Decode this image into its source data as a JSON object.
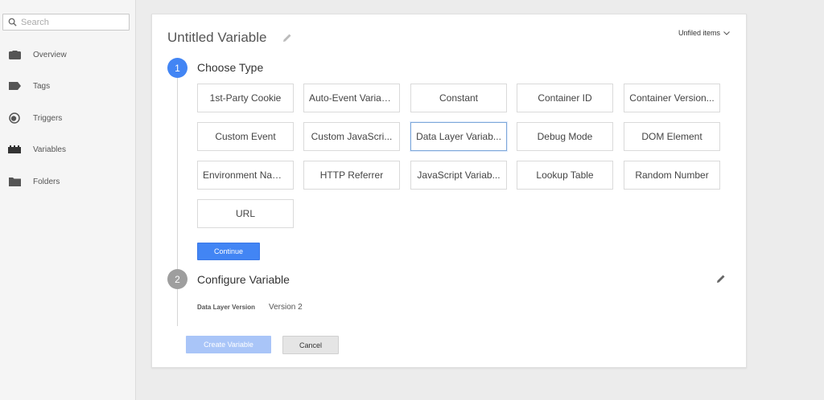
{
  "sidebar": {
    "search_placeholder": "Search",
    "items": [
      {
        "label": "Overview",
        "icon": "briefcase-icon"
      },
      {
        "label": "Tags",
        "icon": "tag-icon"
      },
      {
        "label": "Triggers",
        "icon": "trigger-icon"
      },
      {
        "label": "Variables",
        "icon": "variables-icon"
      },
      {
        "label": "Folders",
        "icon": "folder-icon"
      }
    ]
  },
  "card": {
    "title": "Untitled Variable",
    "folder_dropdown": "Unfiled items",
    "step1": {
      "number": "1",
      "title": "Choose Type",
      "types": [
        "1st-Party Cookie",
        "Auto-Event Variab...",
        "Constant",
        "Container ID",
        "Container Version...",
        "Custom Event",
        "Custom JavaScri...",
        "Data Layer Variab...",
        "Debug Mode",
        "DOM Element",
        "Environment Nam...",
        "HTTP Referrer",
        "JavaScript Variab...",
        "Lookup Table",
        "Random Number",
        "URL"
      ],
      "selected_type": "Data Layer Variab...",
      "continue_label": "Continue"
    },
    "step2": {
      "number": "2",
      "title": "Configure Variable",
      "field_label": "Data Layer Version",
      "field_value": "Version 2"
    },
    "create_label": "Create Variable",
    "cancel_label": "Cancel"
  },
  "colors": {
    "accent": "#4285f4",
    "step_inactive": "#9e9e9e",
    "create_disabled": "#a9c5f8"
  }
}
